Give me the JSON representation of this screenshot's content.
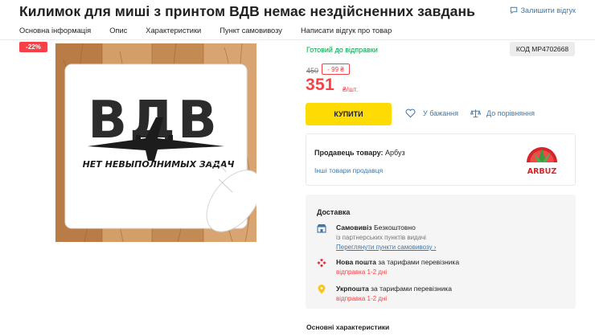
{
  "product": {
    "title": "Килимок для миші з принтом ВДВ немає нездійсненних завдань",
    "review_link": "Залишити відгук",
    "image_text": {
      "big_letters": "ВДВ",
      "slogan": "НЕТ НЕВЫПОЛНИМЫХ ЗАДАЧ"
    }
  },
  "tabs": [
    {
      "label": "Основна інформація"
    },
    {
      "label": "Опис"
    },
    {
      "label": "Характеристики"
    },
    {
      "label": "Пункт самовивозу"
    },
    {
      "label": "Написати відгук про товар"
    }
  ],
  "badge": {
    "discount_percent": "-22%"
  },
  "status": "Готовий до відправки",
  "code": "КОД МР4702668",
  "price": {
    "old": "450",
    "discount": "- 99 ₴",
    "current": "351",
    "unit": "₴/шт."
  },
  "actions": {
    "buy": "КУПИТИ",
    "wishlist": "У бажання",
    "compare": "До порівняння"
  },
  "seller": {
    "label": "Продавець товару:",
    "name": "Арбуз",
    "other_goods": "Інші товари продавця",
    "logo_text": "ARBUZ"
  },
  "delivery": {
    "title": "Доставка",
    "pickup": {
      "title": "Самовивіз",
      "price": "Безкоштовно",
      "subtitle": "із партнерських пунктів видачі",
      "link": "Переглянути пункти самовивозу ›"
    },
    "nova_poshta": {
      "title": "Нова пошта",
      "tariff": "за тарифами перевізника",
      "ship": "відправка 1-2 дні"
    },
    "ukrposhta": {
      "title": "Укрпошта",
      "tariff": "за тарифами перевізника",
      "ship": "відправка 1-2 дні"
    }
  },
  "characteristics_title": "Основні характеристики",
  "colors": {
    "accent_red": "#f84147",
    "buy_yellow": "#fedb03",
    "link_blue": "#3e77aa",
    "ready_green": "#00a046"
  }
}
